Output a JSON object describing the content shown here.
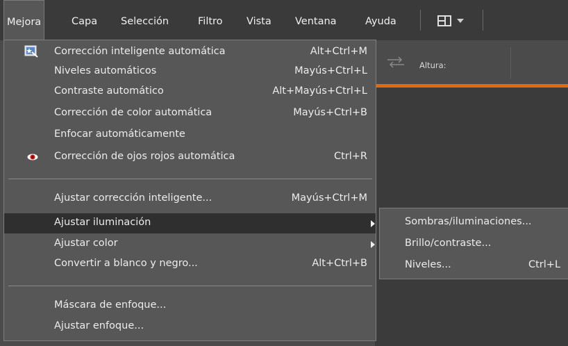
{
  "menubar": {
    "items": [
      "Mejora",
      "Capa",
      "Selección",
      "Filtro",
      "Vista",
      "Ventana",
      "Ayuda"
    ],
    "active": "Mejora",
    "icons": [
      "layout-icon",
      "chevron-down-icon"
    ]
  },
  "toolbar": {
    "height_label": "Altura:",
    "accent_color": "#e06a12"
  },
  "dropdown": {
    "items": [
      {
        "label": "Corrección inteligente automática",
        "shortcut": "Alt+Ctrl+M",
        "icon": "magic-wand-icon"
      },
      {
        "label": "Niveles automáticos",
        "shortcut": "Mayús+Ctrl+L"
      },
      {
        "label": "Contraste automático",
        "shortcut": "Alt+Mayús+Ctrl+L"
      },
      {
        "label": "Corrección de color automática",
        "shortcut": "Mayús+Ctrl+B"
      },
      {
        "label": "Enfocar automáticamente",
        "shortcut": ""
      },
      {
        "label": "Corrección de ojos rojos automática",
        "shortcut": "Ctrl+R",
        "icon": "red-eye-icon"
      },
      {
        "label": "Ajustar corrección inteligente...",
        "shortcut": "Mayús+Ctrl+M"
      },
      {
        "label": "Ajustar iluminación",
        "shortcut": "",
        "submenu": true,
        "highlighted": true
      },
      {
        "label": "Ajustar color",
        "shortcut": "",
        "submenu": true
      },
      {
        "label": "Convertir a blanco y negro...",
        "shortcut": "Alt+Ctrl+B"
      },
      {
        "label": "Máscara de enfoque...",
        "shortcut": ""
      },
      {
        "label": "Ajustar enfoque...",
        "shortcut": ""
      }
    ]
  },
  "submenu": {
    "items": [
      {
        "label": "Sombras/iluminaciones...",
        "shortcut": ""
      },
      {
        "label": "Brillo/contraste...",
        "shortcut": ""
      },
      {
        "label": "Niveles...",
        "shortcut": "Ctrl+L"
      }
    ]
  }
}
